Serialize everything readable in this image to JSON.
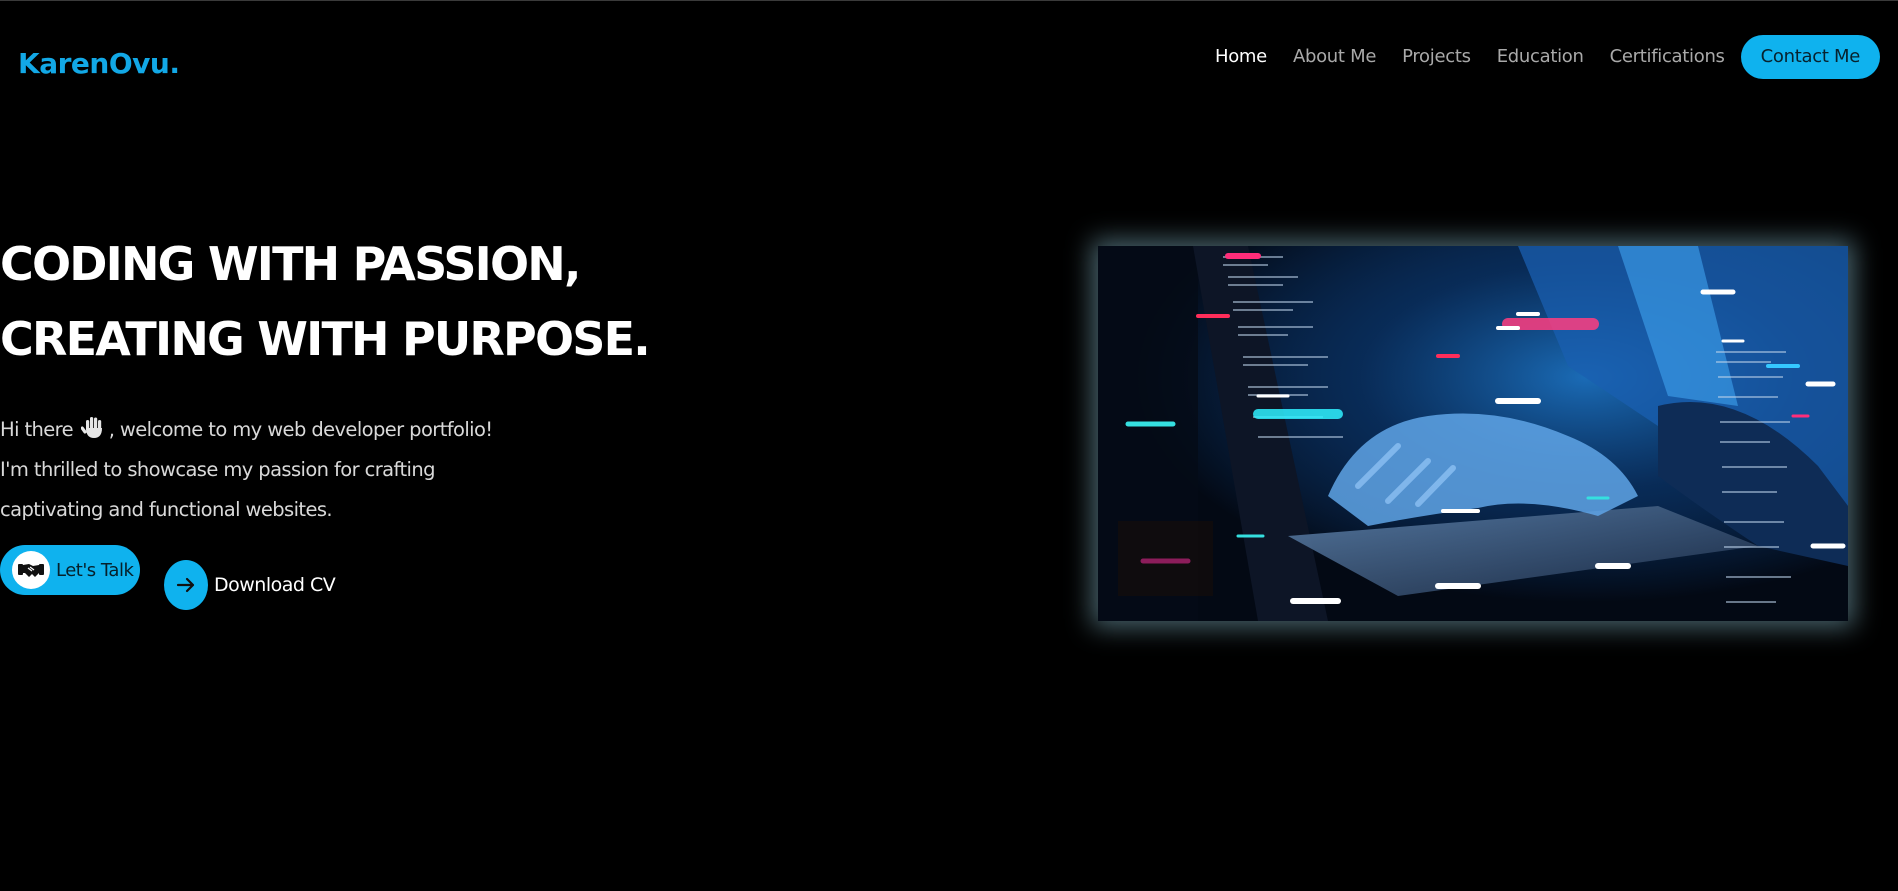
{
  "brand": {
    "logo": "KarenOvu."
  },
  "nav": {
    "items": [
      {
        "label": "Home",
        "active": true
      },
      {
        "label": "About Me",
        "active": false
      },
      {
        "label": "Projects",
        "active": false
      },
      {
        "label": "Education",
        "active": false
      },
      {
        "label": "Certifications",
        "active": false
      }
    ],
    "contact_label": "Contact Me"
  },
  "hero": {
    "headline_line1": "CODING WITH PASSION,",
    "headline_line2": "CREATING WITH PURPOSE.",
    "intro_greeting": "Hi there",
    "intro_rest": ", welcome to my web developer portfolio!",
    "intro_line2": "I'm thrilled to showcase my passion for crafting",
    "intro_line3": "captivating and functional websites.",
    "talk_label": "Let's Talk",
    "cv_label": "Download CV",
    "icons": {
      "greeting": "hand-wave-icon",
      "talk": "handshake-icon",
      "cv": "arrow-right-icon"
    },
    "image_subject": "hands typing on laptop with floating code"
  },
  "colors": {
    "accent": "#0fb2ee",
    "logo": "#12a8e6",
    "background": "#000000",
    "nav_inactive": "#a9a9a9",
    "nav_active": "#ffffff"
  }
}
